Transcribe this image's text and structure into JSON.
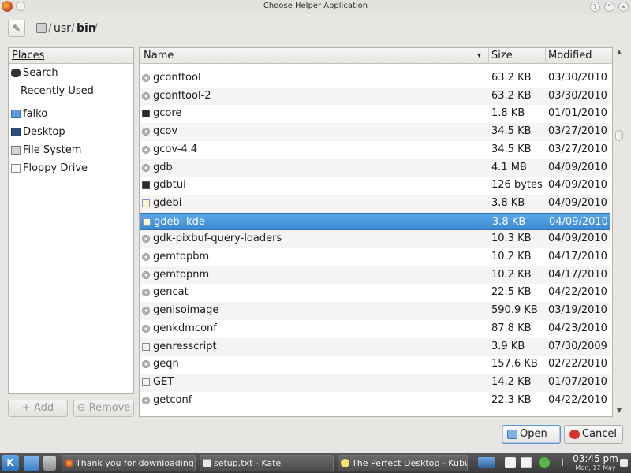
{
  "window": {
    "title": "Choose Helper Application",
    "buttons": {
      "help": "?",
      "minimize": "^",
      "maximize": "^",
      "close": "×"
    }
  },
  "toolbar": {
    "edit_icon": "pencil-icon",
    "breadcrumb": [
      "usr",
      "bin"
    ],
    "separator": "/"
  },
  "places": {
    "header": "Places",
    "items": [
      {
        "label": "Search",
        "icon": "binoculars-icon"
      },
      {
        "label": "Recently Used",
        "icon": "recent-icon"
      },
      {
        "label": "falko",
        "icon": "home-folder-icon"
      },
      {
        "label": "Desktop",
        "icon": "desktop-icon"
      },
      {
        "label": "File System",
        "icon": "drive-icon"
      },
      {
        "label": "Floppy Drive",
        "icon": "floppy-icon"
      }
    ],
    "add_label": "Add",
    "remove_label": "Remove"
  },
  "files": {
    "columns": {
      "name": "Name",
      "size": "Size",
      "modified": "Modified"
    },
    "rows": [
      {
        "name": "gconftool",
        "size": "63.2 KB",
        "modified": "03/30/2010",
        "icon": "exec"
      },
      {
        "name": "gconftool-2",
        "size": "63.2 KB",
        "modified": "03/30/2010",
        "icon": "exec"
      },
      {
        "name": "gcore",
        "size": "1.8 KB",
        "modified": "01/01/2010",
        "icon": "term"
      },
      {
        "name": "gcov",
        "size": "34.5 KB",
        "modified": "03/27/2010",
        "icon": "exec"
      },
      {
        "name": "gcov-4.4",
        "size": "34.5 KB",
        "modified": "03/27/2010",
        "icon": "exec"
      },
      {
        "name": "gdb",
        "size": "4.1 MB",
        "modified": "04/09/2010",
        "icon": "exec"
      },
      {
        "name": "gdbtui",
        "size": "126 bytes",
        "modified": "04/09/2010",
        "icon": "term"
      },
      {
        "name": "gdebi",
        "size": "3.8 KB",
        "modified": "04/09/2010",
        "icon": "py"
      },
      {
        "name": "gdebi-kde",
        "size": "3.8 KB",
        "modified": "04/09/2010",
        "icon": "py",
        "selected": true
      },
      {
        "name": "gdk-pixbuf-query-loaders",
        "size": "10.3 KB",
        "modified": "04/09/2010",
        "icon": "exec"
      },
      {
        "name": "gemtopbm",
        "size": "10.2 KB",
        "modified": "04/17/2010",
        "icon": "exec"
      },
      {
        "name": "gemtopnm",
        "size": "10.2 KB",
        "modified": "04/17/2010",
        "icon": "exec"
      },
      {
        "name": "gencat",
        "size": "22.5 KB",
        "modified": "04/22/2010",
        "icon": "exec"
      },
      {
        "name": "genisoimage",
        "size": "590.9 KB",
        "modified": "03/19/2010",
        "icon": "exec"
      },
      {
        "name": "genkdmconf",
        "size": "87.8 KB",
        "modified": "04/23/2010",
        "icon": "exec"
      },
      {
        "name": "genresscript",
        "size": "3.9 KB",
        "modified": "07/30/2009",
        "icon": "script"
      },
      {
        "name": "geqn",
        "size": "157.6 KB",
        "modified": "02/22/2010",
        "icon": "exec"
      },
      {
        "name": "GET",
        "size": "14.2 KB",
        "modified": "01/07/2010",
        "icon": "script"
      },
      {
        "name": "getconf",
        "size": "22.3 KB",
        "modified": "04/22/2010",
        "icon": "exec"
      }
    ]
  },
  "dialog": {
    "open_label": "Open",
    "cancel_label": "Cancel"
  },
  "taskbar": {
    "kmenu": "K",
    "tasks": [
      {
        "label": "Thank you for downloading Op"
      },
      {
        "label": "setup.txt - Kate"
      },
      {
        "label": "The Perfect Desktop - Kubuntu"
      }
    ],
    "tray_info": "i",
    "time": "03:45 pm",
    "date": "Mon, 17 May"
  }
}
